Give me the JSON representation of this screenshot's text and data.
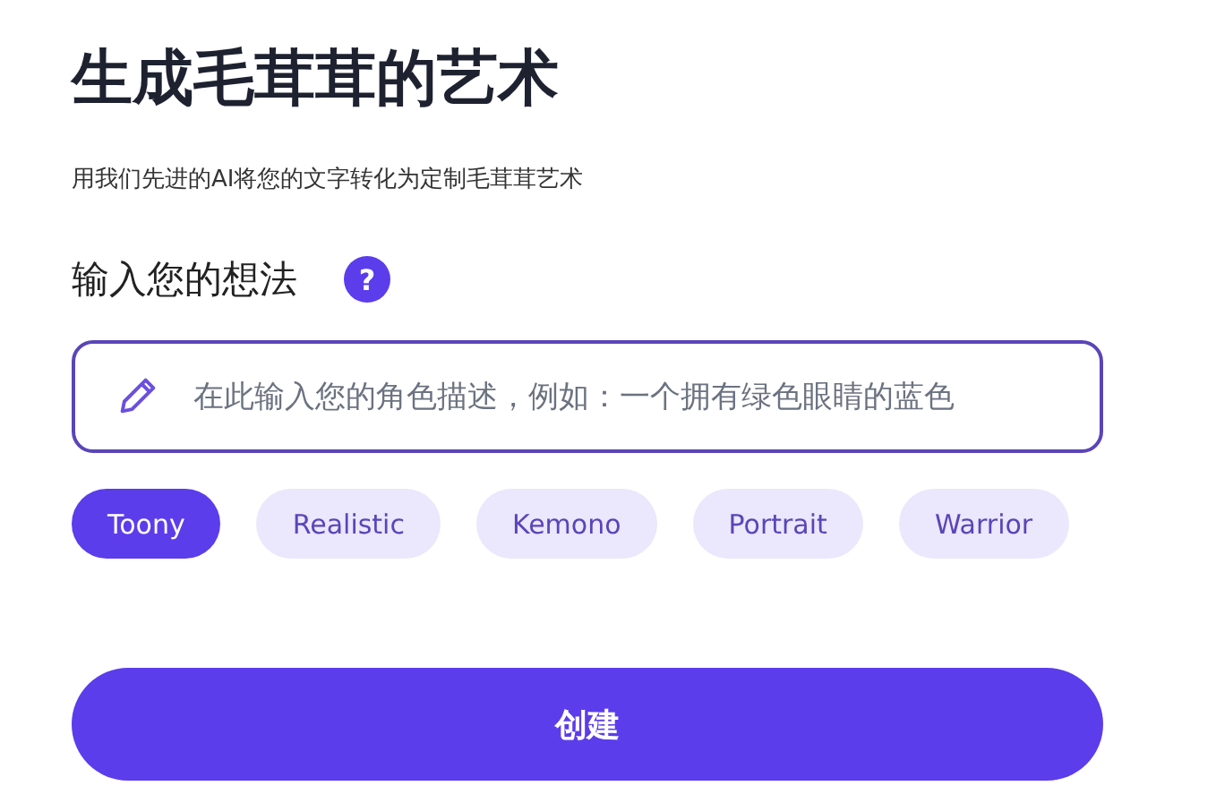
{
  "title": "生成毛茸茸的艺术",
  "subtitle": "用我们先进的AI将您的文字转化为定制毛茸茸艺术",
  "prompt_label": "输入您的想法",
  "help": "?",
  "prompt_field": {
    "placeholder": "在此输入您的角色描述，例如：一个拥有绿色眼睛的蓝色"
  },
  "styles": [
    {
      "label": "Toony",
      "selected": true
    },
    {
      "label": "Realistic",
      "selected": false
    },
    {
      "label": "Kemono",
      "selected": false
    },
    {
      "label": "Portrait",
      "selected": false
    },
    {
      "label": "Warrior",
      "selected": false
    }
  ],
  "create_button": "创建"
}
